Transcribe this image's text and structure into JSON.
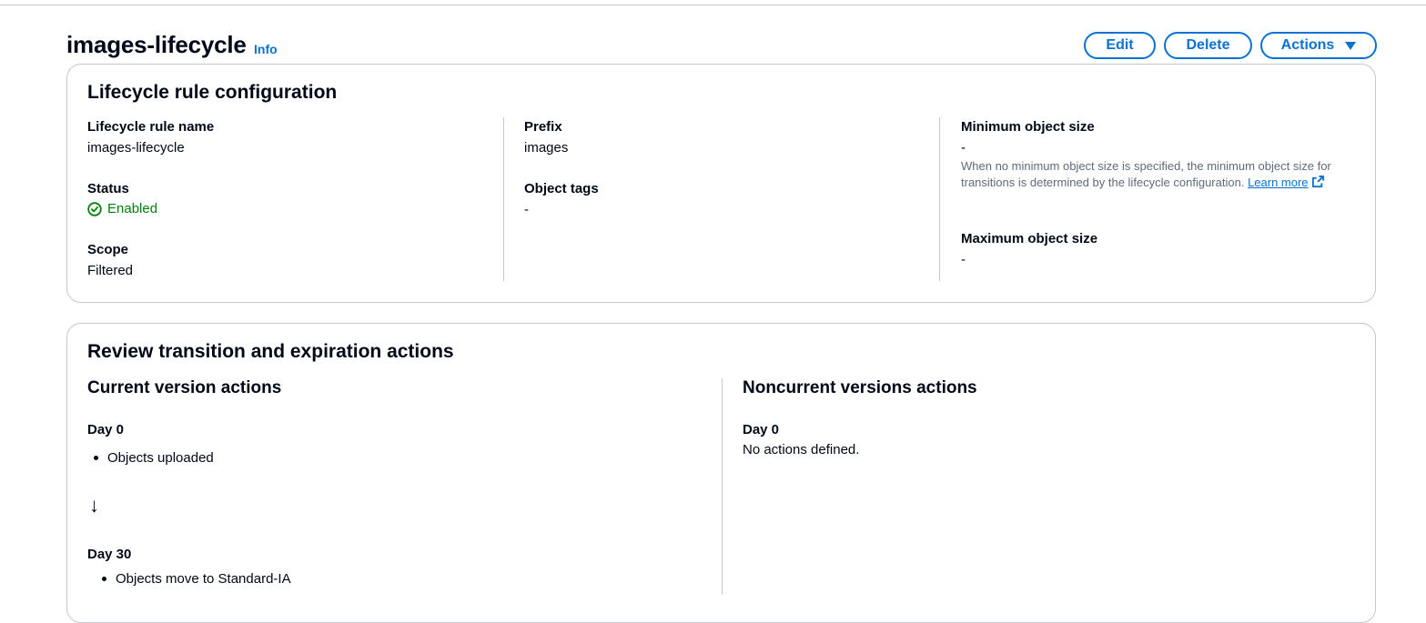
{
  "header": {
    "title": "images-lifecycle",
    "info_label": "Info",
    "edit_label": "Edit",
    "delete_label": "Delete",
    "actions_label": "Actions"
  },
  "config": {
    "title": "Lifecycle rule configuration",
    "rule_name_label": "Lifecycle rule name",
    "rule_name_value": "images-lifecycle",
    "status_label": "Status",
    "status_value": "Enabled",
    "scope_label": "Scope",
    "scope_value": "Filtered",
    "prefix_label": "Prefix",
    "prefix_value": "images",
    "tags_label": "Object tags",
    "tags_value": "-",
    "min_size_label": "Minimum object size",
    "min_size_value": "-",
    "min_size_desc": "When no minimum object size is specified, the minimum object size for transitions is determined by the lifecycle configuration.",
    "learn_more": "Learn more",
    "max_size_label": "Maximum object size",
    "max_size_value": "-"
  },
  "review": {
    "title": "Review transition and expiration actions",
    "current": {
      "title": "Current version actions",
      "day0_label": "Day 0",
      "day0_item": "Objects uploaded",
      "arrow": "↓",
      "day30_label": "Day 30",
      "day30_item": "Objects move to Standard-IA"
    },
    "noncurrent": {
      "title": "Noncurrent versions actions",
      "day0_label": "Day 0",
      "day0_text": "No actions defined."
    }
  },
  "colors": {
    "link": "#0972d3",
    "success": "#037f0c",
    "border": "#c6c6cd"
  },
  "icons": [
    "status-success-icon",
    "external-link-icon",
    "caret-down-icon"
  ]
}
